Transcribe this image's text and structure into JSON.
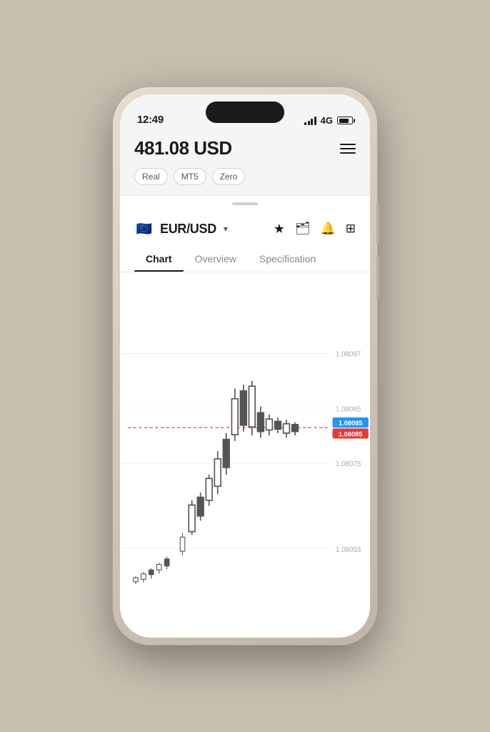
{
  "status_bar": {
    "time": "12:49",
    "network": "4G"
  },
  "header": {
    "balance": "481.08 USD",
    "tags": [
      "Real",
      "MT5",
      "Zero"
    ],
    "menu_icon": "hamburger"
  },
  "instrument": {
    "name": "EUR/USD",
    "flag_emoji": "🇪🇺",
    "has_dropdown": true
  },
  "toolbar_icons": {
    "star": "★",
    "briefcase": "💼",
    "bell": "🔔",
    "calculator": "🖩"
  },
  "tabs": [
    {
      "label": "Chart",
      "active": true
    },
    {
      "label": "Overview",
      "active": false
    },
    {
      "label": "Specification",
      "active": false
    }
  ],
  "chart": {
    "price_labels": [
      "1.08097",
      "1.08085",
      "1.08075",
      "1.08053"
    ],
    "ask_price": "1.08085",
    "bid_price": "1.08085",
    "dotted_line_y_pct": 42
  }
}
